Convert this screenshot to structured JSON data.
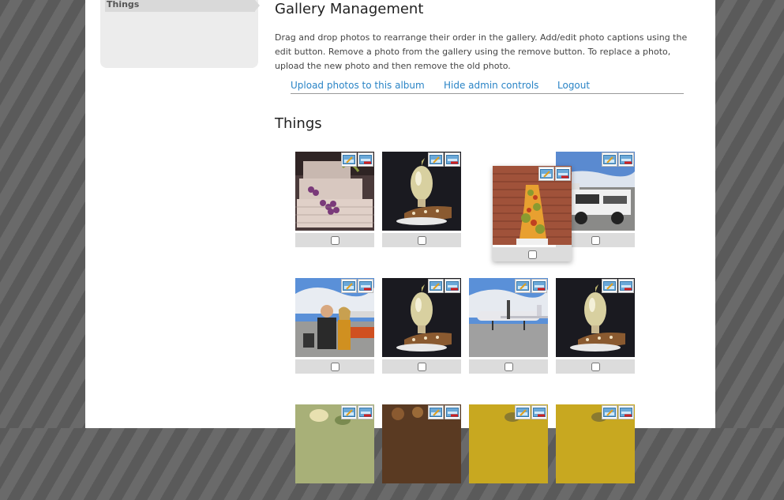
{
  "sidebar": {
    "items": [
      {
        "label": "Things"
      }
    ]
  },
  "page_title": "Gallery Management",
  "description": "Drag and drop photos to rearrange their order in the gallery. Add/edit photo captions using the edit button. Remove a photo from the gallery using the remove button. To replace a photo, upload the new photo and then remove the old photo.",
  "admin_nav": {
    "upload": "Upload photos to this album",
    "hide": "Hide admin controls",
    "logout": "Logout"
  },
  "album_title": "Things",
  "photos": [
    {
      "subject": "mosaic cake with grapes"
    },
    {
      "subject": "light bulb cake"
    },
    {
      "subject": "airport ground vehicle"
    },
    {
      "subject": "tall leaf cake",
      "state": "being dragged"
    },
    {
      "subject": "couple at airport"
    },
    {
      "subject": "light bulb cake"
    },
    {
      "subject": "airplane on tarmac"
    },
    {
      "subject": "light bulb cake"
    },
    {
      "subject": "green cake"
    },
    {
      "subject": "brown cake"
    },
    {
      "subject": "yellow cake"
    },
    {
      "subject": "yellow cake"
    }
  ]
}
